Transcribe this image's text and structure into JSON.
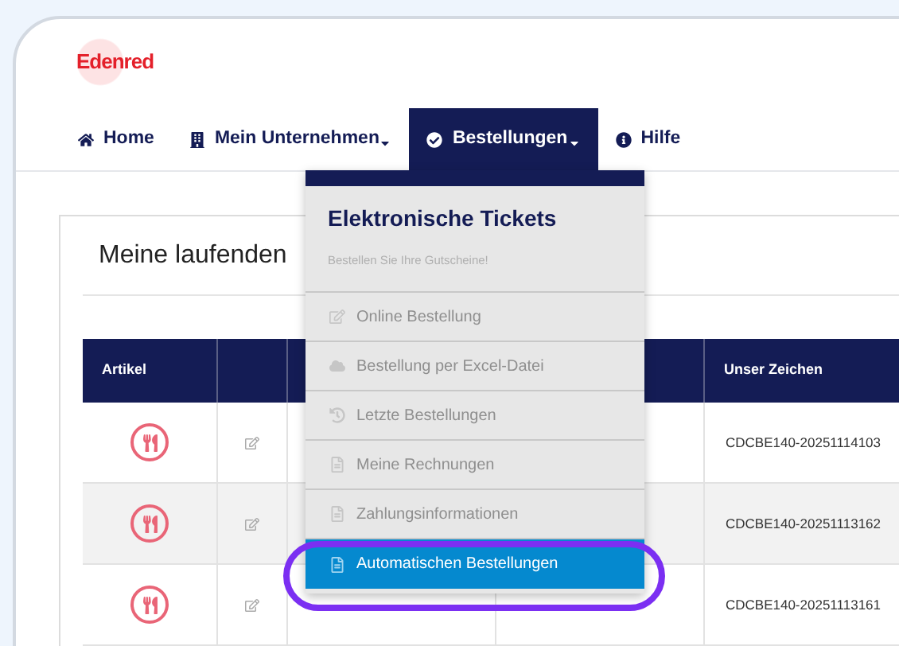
{
  "logo": {
    "text": "Edenred"
  },
  "nav": [
    {
      "label": "Home",
      "dropdown": false,
      "selected": false
    },
    {
      "label": "Mein Unternehmen",
      "dropdown": true,
      "selected": false
    },
    {
      "label": "Bestellungen",
      "dropdown": true,
      "selected": true
    },
    {
      "label": "Hilfe",
      "dropdown": false,
      "selected": false
    }
  ],
  "panel": {
    "title": "Meine laufenden"
  },
  "table": {
    "column_1": "Artikel",
    "column_5": "Unser Zeichen",
    "rows": [
      {
        "unser_zeichen": "CDCBE140-20251114103"
      },
      {
        "unser_zeichen": "CDCBE140-20251113162"
      },
      {
        "unser_zeichen": "CDCBE140-20251113161"
      }
    ]
  },
  "dropdown": {
    "title": "Elektronische Tickets",
    "subtitle": "Bestellen Sie Ihre Gutscheine!",
    "items": [
      {
        "label": "Online Bestellung",
        "selected": false
      },
      {
        "label": "Bestellung per Excel-Datei",
        "selected": false
      },
      {
        "label": "Letzte Bestellungen",
        "selected": false
      },
      {
        "label": "Meine Rechnungen",
        "selected": false
      },
      {
        "label": "Zahlungsinformationen",
        "selected": false
      },
      {
        "label": "Automatischen Bestellungen",
        "selected": true
      }
    ]
  }
}
